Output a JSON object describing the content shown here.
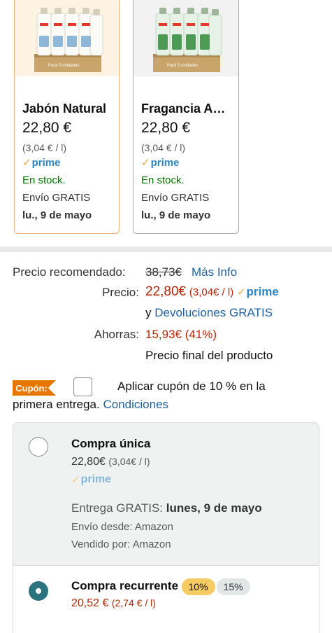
{
  "variants": [
    {
      "name": "Jabón Natural",
      "price": "22,80 €",
      "unit_price": "(3,04 € / l)",
      "prime": "prime",
      "stock": "En stock.",
      "shipping": "Envío GRATIS",
      "delivery": "lu., 9 de mayo",
      "pack_label": "Pack 5 unidades",
      "selected": true
    },
    {
      "name": "Fragancia A…",
      "price": "22,80 €",
      "unit_price": "(3,04 € / l)",
      "prime": "prime",
      "stock": "En stock.",
      "shipping": "Envío GRATIS",
      "delivery": "lu., 9 de mayo",
      "pack_label": "Pack 5 unidades",
      "selected": false
    }
  ],
  "pricing": {
    "list_label": "Precio recomendado:",
    "list_price": "38,73€",
    "more_info": "Más Info",
    "price_label": "Precio:",
    "price": "22,80€",
    "price_unit": "(3,04€ / l)",
    "prime": "prime",
    "returns_prefix": "y",
    "returns_link": "Devoluciones GRATIS",
    "savings_label": "Ahorras:",
    "savings": "15,93€ (41%)",
    "final_note": "Precio final del producto"
  },
  "coupon": {
    "badge": "Cupón:",
    "line1": "Aplicar cupón de 10 % en la",
    "line2": "primera entrega.",
    "conditions": "Condiciones",
    "checked": false
  },
  "purchase_options": {
    "one_time": {
      "title": "Compra única",
      "price": "22,80€",
      "unit": "(3,04€ / l)",
      "prime": "prime",
      "delivery_label": "Entrega GRATIS:",
      "delivery_date": "lunes, 9 de mayo",
      "ships_from": "Envío desde: Amazon",
      "sold_by": "Vendido por: Amazon",
      "selected": false
    },
    "recurring": {
      "title": "Compra recurrente",
      "tag_selected": "10%",
      "tag_other": "15%",
      "price": "20,52 €",
      "unit": "(2,74 € / l)",
      "selected": true
    }
  },
  "colors": {
    "selected_border": "#e8b37a",
    "price_red": "#b12704",
    "stock_green": "#007600",
    "link_blue": "#2162a1",
    "prime_check": "#f3a847",
    "coupon_orange": "#e77600",
    "radio_teal": "#2a737f"
  }
}
